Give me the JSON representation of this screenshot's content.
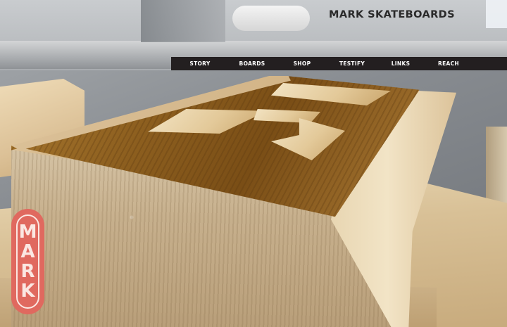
{
  "header": {
    "brand": "MARK SKATEBOARDS"
  },
  "nav": {
    "items": [
      {
        "label": "STORY"
      },
      {
        "label": "BOARDS"
      },
      {
        "label": "SHOP"
      },
      {
        "label": "TESTIFY"
      },
      {
        "label": "LINKS"
      },
      {
        "label": "REACH"
      }
    ]
  },
  "logo": {
    "letters": [
      "M",
      "A",
      "R",
      "K"
    ]
  },
  "colors": {
    "nav_background": "#231f20",
    "logo_red": "#e0695f"
  }
}
